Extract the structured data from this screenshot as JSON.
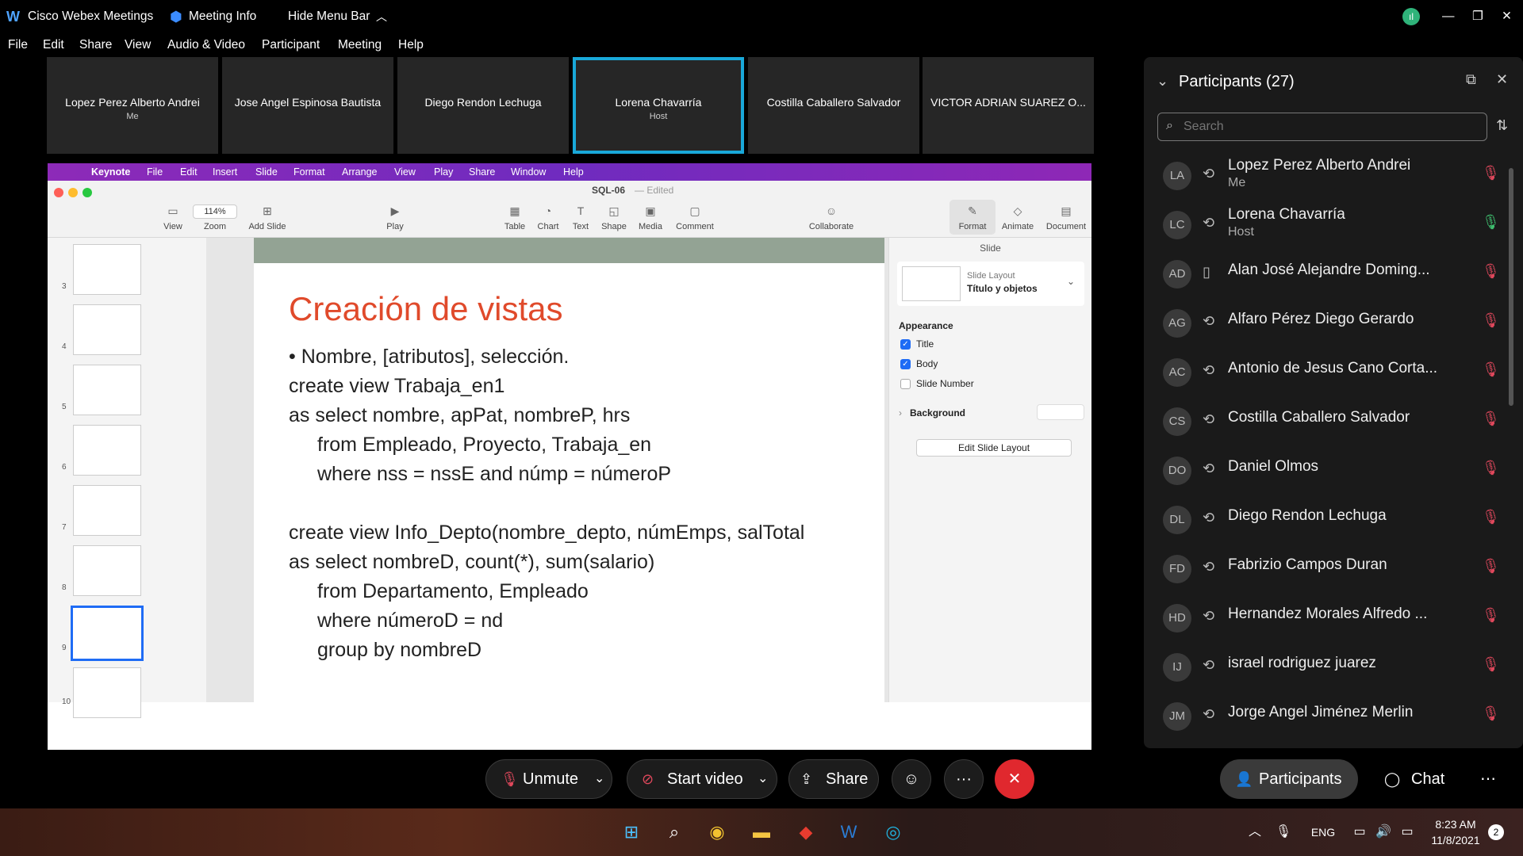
{
  "titlebar": {
    "app_name": "Cisco Webex Meetings",
    "meeting_info": "Meeting Info",
    "hide_menu_bar": "Hide Menu Bar"
  },
  "menu": [
    "File",
    "Edit",
    "Share",
    "View",
    "Audio & Video",
    "Participant",
    "Meeting",
    "Help"
  ],
  "video_strip": [
    {
      "name": "Lopez Perez Alberto Andrei",
      "sub": "Me"
    },
    {
      "name": "Jose Angel Espinosa Bautista",
      "sub": ""
    },
    {
      "name": "Diego Rendon Lechuga",
      "sub": ""
    },
    {
      "name": "Lorena Chavarría",
      "sub": "Host"
    },
    {
      "name": "Costilla Caballero Salvador",
      "sub": ""
    },
    {
      "name": "VICTOR ADRIAN SUAREZ O...",
      "sub": ""
    }
  ],
  "shared": {
    "mac_menu": [
      "Keynote",
      "File",
      "Edit",
      "Insert",
      "Slide",
      "Format",
      "Arrange",
      "View",
      "Play",
      "Share",
      "Window",
      "Help"
    ],
    "doc_title": "SQL-06",
    "doc_status": "— Edited",
    "zoom": "114%",
    "toolbar": [
      "View",
      "Zoom",
      "Add Slide",
      "Play",
      "Table",
      "Chart",
      "Text",
      "Shape",
      "Media",
      "Comment",
      "Collaborate",
      "Format",
      "Animate",
      "Document"
    ],
    "slide_numbers": [
      "3",
      "4",
      "5",
      "6",
      "7",
      "8",
      "9",
      "10"
    ],
    "slide_title": "Creación de vistas",
    "slide_lines": [
      "• Nombre, [atributos], selección.",
      "create view Trabaja_en1",
      "as select nombre, apPat, nombreP, hrs",
      "from Empleado, Proyecto, Trabaja_en",
      "where nss = nssE and númp = númeroP",
      "create view Info_Depto(nombre_depto, númEmps, salTotal",
      "as select nombreD, count(*), sum(salario)",
      "from Departamento, Empleado",
      "where númeroD = nd",
      "group by nombreD"
    ],
    "inspector": {
      "tab": "Slide",
      "layout_label": "Slide Layout",
      "layout_value": "Título y objetos",
      "appearance": "Appearance",
      "title_cb": "Title",
      "body_cb": "Body",
      "slide_number_cb": "Slide Number",
      "background": "Background",
      "edit_layout": "Edit Slide Layout"
    }
  },
  "participants": {
    "header": "Participants (27)",
    "search_placeholder": "Search",
    "list": [
      {
        "initials": "LA",
        "name": "Lopez Perez Alberto Andrei",
        "sub": "Me"
      },
      {
        "initials": "LC",
        "name": "Lorena Chavarría",
        "sub": "Host"
      },
      {
        "initials": "AD",
        "name": "Alan José Alejandre Doming...",
        "sub": ""
      },
      {
        "initials": "AG",
        "name": "Alfaro Pérez Diego Gerardo",
        "sub": ""
      },
      {
        "initials": "AC",
        "name": "Antonio de Jesus Cano Corta...",
        "sub": ""
      },
      {
        "initials": "CS",
        "name": "Costilla Caballero Salvador",
        "sub": ""
      },
      {
        "initials": "DO",
        "name": "Daniel Olmos",
        "sub": ""
      },
      {
        "initials": "DL",
        "name": "Diego Rendon Lechuga",
        "sub": ""
      },
      {
        "initials": "FD",
        "name": "Fabrizio Campos Duran",
        "sub": ""
      },
      {
        "initials": "HD",
        "name": "Hernandez Morales Alfredo ...",
        "sub": ""
      },
      {
        "initials": "IJ",
        "name": "israel rodriguez juarez",
        "sub": ""
      },
      {
        "initials": "JM",
        "name": "Jorge Angel Jiménez Merlin",
        "sub": ""
      }
    ]
  },
  "controls": {
    "unmute": "Unmute",
    "start_video": "Start video",
    "share": "Share",
    "participants": "Participants",
    "chat": "Chat"
  },
  "taskbar": {
    "lang": "ENG",
    "time": "8:23 AM",
    "date": "11/8/2021",
    "notifications": "2"
  }
}
